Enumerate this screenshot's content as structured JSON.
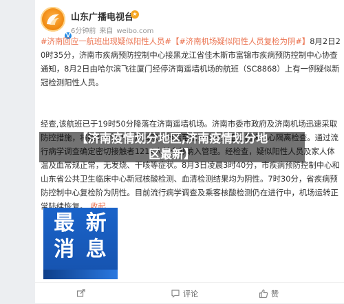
{
  "post": {
    "author": "山东广播电视台",
    "badge_icon": "v-badge-icon",
    "time": "6分钟前",
    "source": "来自",
    "domain": "weibo.com",
    "paragraph1_tag1": "#济南回应一航班出现疑似阳性人员#",
    "paragraph1_tag2": "【#济南机场疑似阳性人员复检为阴#】",
    "paragraph1_text": "8月2日20时35分，济南市疾病预防控制中心接黑龙江省佳木斯市富锦市疾病预防控制中心协查通知，8月2日由哈尔滨飞往厦门经停济南遥墙机场的航班（SC8868）上有一例疑似新冠检测阳性人员。",
    "paragraph2_text": "经查,该航班已于19时50分降落在济南遥墙机场。济南市委市政府及济南机场迅速采取防控措施，将疑似阳性人员及其家人转运至山东省公共卫生临床中心隔离检查。通过流行病学调查确定密切接触者1214人并全部纳入管理。经检查，疑似阳性人员及家人体温及血常规正常，无发烧、干咳等症状。8月3日凌晨3时40分，市疾病预防控制中心和山东省公共卫生临床中心新冠核酸检测、血清检测结果均为阴性。7时30分，省疾病预防控制中心复检阶为阴性。目前流行病学调查及乘客核酸检测仍在进行中，机场运转正常陆续恢复。",
    "more_label": "收起",
    "image_text_line1": "最 新",
    "image_text_line2": "消 息"
  },
  "overlay": {
    "line1": "【济南疫情划分地区,济南疫情划分地",
    "line2": "区最新】"
  },
  "actions": {
    "share": "",
    "comment": "评论",
    "like": "赞"
  },
  "colors": {
    "accent": "#eb7350",
    "verified": "#1e88e5",
    "image_bg": "#1a63c9"
  }
}
